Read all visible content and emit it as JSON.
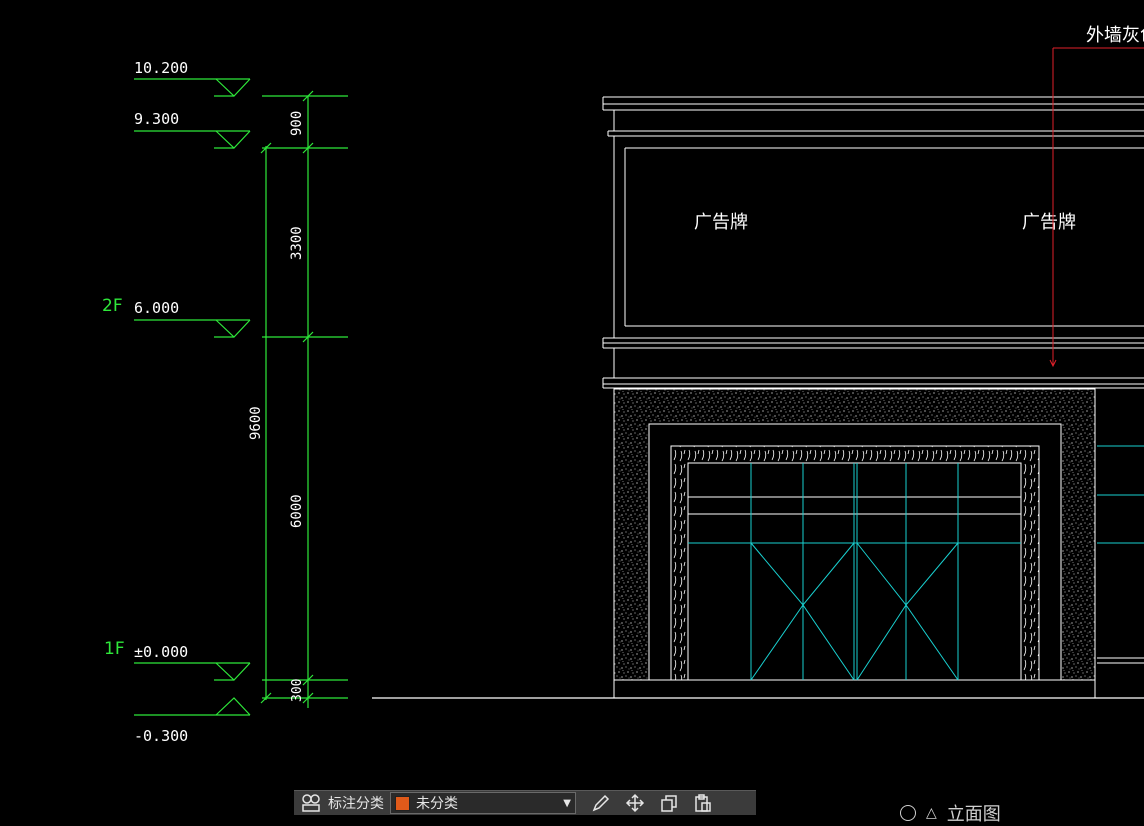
{
  "levels": [
    {
      "value": "10.200",
      "floor": ""
    },
    {
      "value": "9.300",
      "floor": ""
    },
    {
      "value": "6.000",
      "floor": "2F"
    },
    {
      "value": "±0.000",
      "floor": "1F"
    },
    {
      "value": "-0.300",
      "floor": ""
    }
  ],
  "dimensions": {
    "inner": [
      "900",
      "3300",
      "6000",
      "300"
    ],
    "outer": "9600"
  },
  "facade": {
    "signs": [
      "广告牌",
      "广告牌"
    ],
    "leader_note": "外墙灰色"
  },
  "toolbar": {
    "category_label": "标注分类",
    "category_value": "未分类",
    "category_color": "#e05a1a",
    "icons": [
      "category-manager-icon",
      "edit-icon",
      "move-icon",
      "copy-icon",
      "paste-icon"
    ]
  },
  "view": {
    "label": "立面图"
  },
  "colors": {
    "background": "#000000",
    "dimension_green": "#2ee83a",
    "line_white": "#ffffff",
    "glass_cyan": "#19d0d0",
    "leader_red": "#e0202a"
  }
}
